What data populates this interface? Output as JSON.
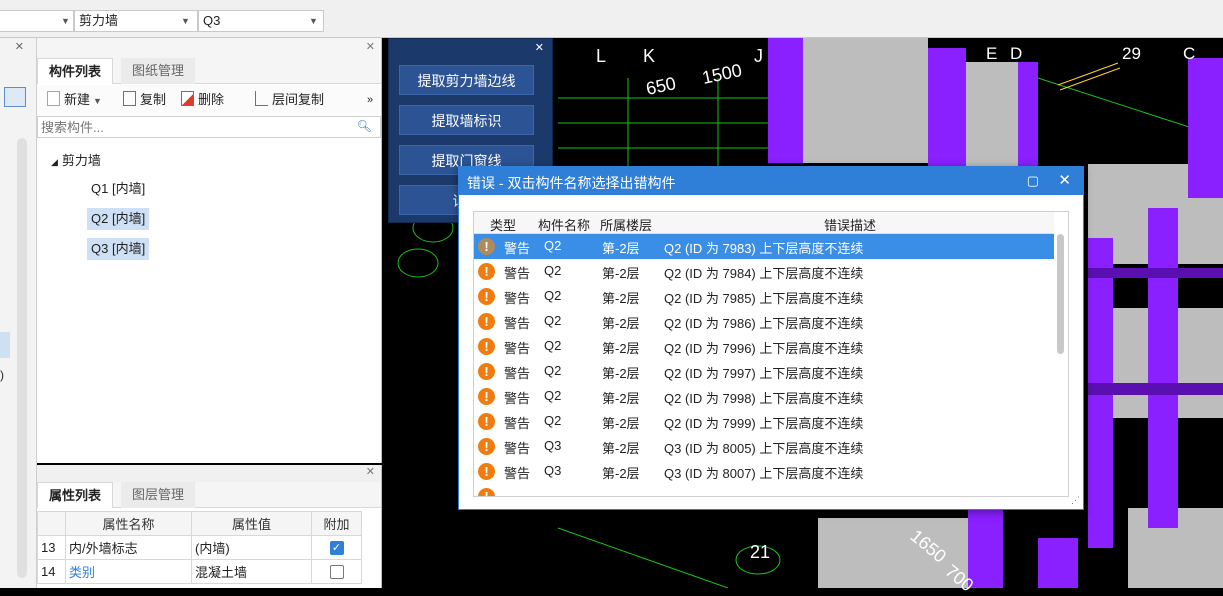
{
  "topbar": {
    "combo1": "",
    "combo2": "剪力墙",
    "combo3": "Q3"
  },
  "left_strip": {
    "paren": ")"
  },
  "component_panel": {
    "tabs": [
      "构件列表",
      "图纸管理"
    ],
    "toolbar": {
      "new": "新建",
      "copy": "复制",
      "delete": "删除",
      "floor_copy": "层间复制",
      "more": "»"
    },
    "search_placeholder": "搜索构件...",
    "tree_root": "剪力墙",
    "tree_items": [
      "Q1 [内墙]",
      "Q2 [内墙]",
      "Q3 [内墙]"
    ]
  },
  "attribute_panel": {
    "tabs": [
      "属性列表",
      "图层管理"
    ],
    "headers": [
      "属性名称",
      "属性值",
      "附加"
    ],
    "rows": [
      {
        "num": "13",
        "name": "内/外墙标志",
        "value": "(内墙)",
        "checked": true
      },
      {
        "num": "14",
        "name": "类别",
        "value": "混凝土墙",
        "checked": false
      }
    ]
  },
  "extract_panel": {
    "buttons": [
      "提取剪力墙边线",
      "提取墙标识",
      "提取门窗线",
      "识别"
    ]
  },
  "viewport": {
    "labels": [
      "L",
      "K",
      "J",
      "E",
      "D",
      "29",
      "C",
      "650",
      "1500",
      "21",
      "1650",
      "700"
    ]
  },
  "error_dialog": {
    "title": "错误 - 双击构件名称选择出错构件",
    "columns": [
      "类型",
      "构件名称",
      "所属楼层",
      "错误描述"
    ],
    "rows": [
      {
        "type": "警告",
        "name": "Q2",
        "floor": "第-2层",
        "desc": "Q2 (ID 为 7983) 上下层高度不连续",
        "selected": true
      },
      {
        "type": "警告",
        "name": "Q2",
        "floor": "第-2层",
        "desc": "Q2 (ID 为 7984) 上下层高度不连续"
      },
      {
        "type": "警告",
        "name": "Q2",
        "floor": "第-2层",
        "desc": "Q2 (ID 为 7985) 上下层高度不连续"
      },
      {
        "type": "警告",
        "name": "Q2",
        "floor": "第-2层",
        "desc": "Q2 (ID 为 7986) 上下层高度不连续"
      },
      {
        "type": "警告",
        "name": "Q2",
        "floor": "第-2层",
        "desc": "Q2 (ID 为 7996) 上下层高度不连续"
      },
      {
        "type": "警告",
        "name": "Q2",
        "floor": "第-2层",
        "desc": "Q2 (ID 为 7997) 上下层高度不连续"
      },
      {
        "type": "警告",
        "name": "Q2",
        "floor": "第-2层",
        "desc": "Q2 (ID 为 7998) 上下层高度不连续"
      },
      {
        "type": "警告",
        "name": "Q2",
        "floor": "第-2层",
        "desc": "Q2 (ID 为 7999) 上下层高度不连续"
      },
      {
        "type": "警告",
        "name": "Q3",
        "floor": "第-2层",
        "desc": "Q3 (ID 为 8005) 上下层高度不连续"
      },
      {
        "type": "警告",
        "name": "Q3",
        "floor": "第-2层",
        "desc": "Q3 (ID 为 8007) 上下层高度不连续"
      }
    ]
  },
  "colors": {
    "accent": "#2f7fd8",
    "warning": "#f07c10",
    "selection": "#3b8ee6",
    "wall_purple": "#8a1fff",
    "panel_navy": "#1b3a6b"
  }
}
